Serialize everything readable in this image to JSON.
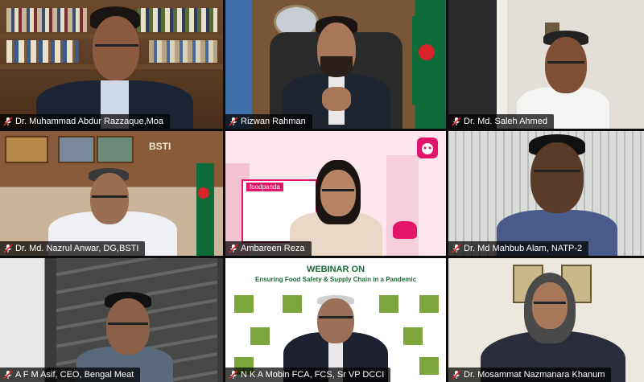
{
  "participants": [
    {
      "name": "Dr. Muhammad Abdur Razzaque,Moa",
      "muted": true,
      "active": true
    },
    {
      "name": "Rizwan Rahman",
      "muted": true,
      "active": false
    },
    {
      "name": "Dr. Md. Saleh Ahmed",
      "muted": true,
      "active": false
    },
    {
      "name": "Dr. Md. Nazrul Anwar, DG,BSTI",
      "muted": true,
      "active": false
    },
    {
      "name": "Ambareen Reza",
      "muted": true,
      "active": false
    },
    {
      "name": "Dr. Md Mahbub Alam, NATP-2",
      "muted": true,
      "active": false
    },
    {
      "name": "A F M Asif, CEO, Bengal Meat",
      "muted": true,
      "active": false
    },
    {
      "name": "N K A Mobin FCA, FCS, Sr VP DCCI",
      "muted": true,
      "active": false
    },
    {
      "name": "Dr. Mosammat Nazmanara Khanum",
      "muted": true,
      "active": false
    }
  ],
  "backgrounds": {
    "bsti_sign": "BSTI",
    "foodpanda_sign": "foodpanda",
    "webinar_heading": "WEBINAR ON",
    "webinar_subtitle": "Ensuring Food Safety & Supply Chain in a Pandemic"
  },
  "colors": {
    "active_border": "#d8e33a",
    "foodpanda_pink": "#e2156b",
    "muted_icon": "#e02424",
    "label_bg": "#000000"
  },
  "icons": {
    "mute": "microphone-muted-icon",
    "app": "foodpanda-app-icon"
  }
}
